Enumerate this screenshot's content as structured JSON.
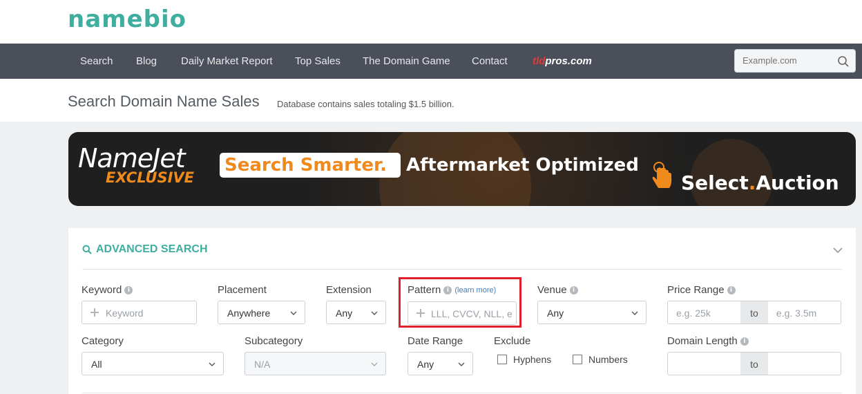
{
  "brand": {
    "logo": "namebio"
  },
  "nav": {
    "items": [
      "Search",
      "Blog",
      "Daily Market Report",
      "Top Sales",
      "The Domain Game",
      "Contact"
    ],
    "tldpros_prefix": "tld",
    "tldpros_suffix": "pros.com",
    "search_placeholder": "Example.com"
  },
  "header": {
    "title": "Search Domain Name Sales",
    "subtitle": "Database contains sales totaling $1.5 billion."
  },
  "banner": {
    "brand": "NameJet",
    "brand_tag": "EXCLUSIVE",
    "headline_a": "Search Smarter",
    "headline_b": "Aftermarket Optimized",
    "cta_a": "Select",
    "cta_b": "Auction"
  },
  "advanced": {
    "title": "ADVANCED SEARCH",
    "keyword": {
      "label": "Keyword",
      "placeholder": "Keyword"
    },
    "placement": {
      "label": "Placement",
      "value": "Anywhere"
    },
    "extension": {
      "label": "Extension",
      "value": "Any"
    },
    "pattern": {
      "label": "Pattern",
      "learn_more": "(learn more)",
      "placeholder": "LLL, CVCV, NLL, e"
    },
    "venue": {
      "label": "Venue",
      "value": "Any"
    },
    "price_range": {
      "label": "Price Range",
      "min_placeholder": "e.g. 25k",
      "to": "to",
      "max_placeholder": "e.g. 3.5m"
    },
    "category": {
      "label": "Category",
      "value": "All"
    },
    "subcategory": {
      "label": "Subcategory",
      "value": "N/A"
    },
    "date_range": {
      "label": "Date Range",
      "value": "Any"
    },
    "exclude": {
      "label": "Exclude",
      "hyphens": "Hyphens",
      "numbers": "Numbers"
    },
    "domain_length": {
      "label": "Domain Length",
      "to": "to"
    }
  },
  "colors": {
    "accent": "#3fae9e",
    "nav_bg": "#4a4f5a",
    "highlight": "#e0202a",
    "banner_orange": "#f08a1c"
  }
}
